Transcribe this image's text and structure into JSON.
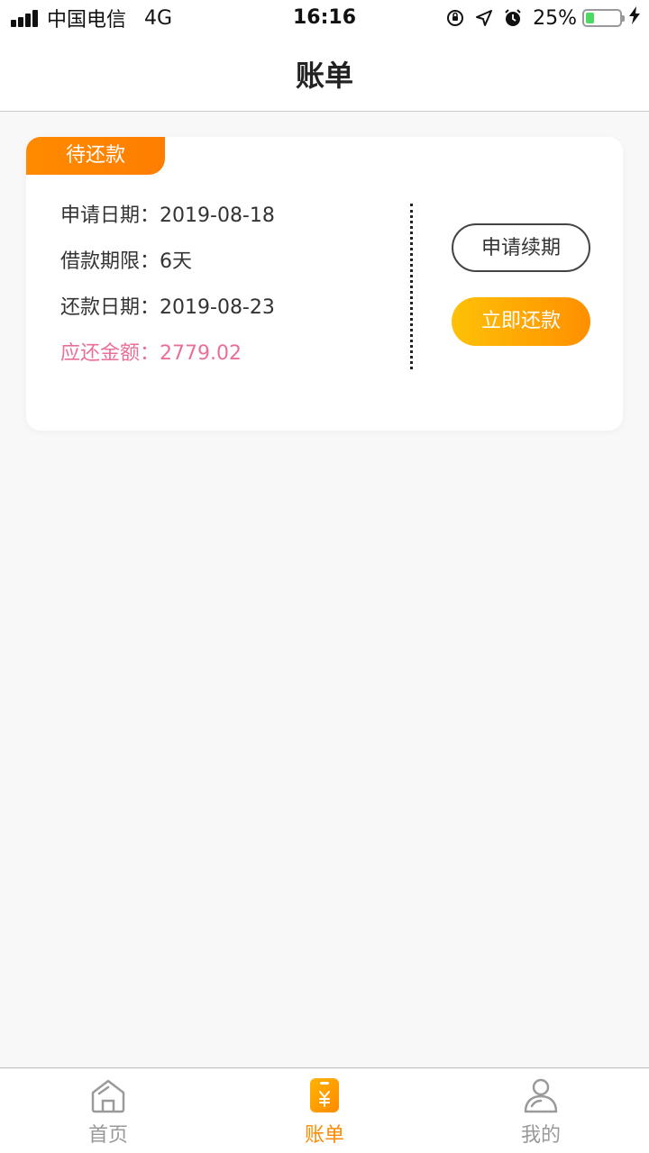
{
  "status_bar": {
    "carrier": "中国电信",
    "network": "4G",
    "time": "16:16",
    "battery_pct": "25%",
    "battery_level": 0.25,
    "icons": [
      "signal-icon",
      "orientation-lock-icon",
      "location-icon",
      "alarm-icon",
      "battery-icon",
      "charging-icon"
    ]
  },
  "nav": {
    "title": "账单"
  },
  "bill": {
    "status": "待还款",
    "rows": [
      {
        "label": "申请日期：",
        "value": "2019-08-18"
      },
      {
        "label": "借款期限：",
        "value": "6天"
      },
      {
        "label": "还款日期：",
        "value": "2019-08-23"
      }
    ],
    "due": {
      "label": "应还金额：",
      "value": "2779.02"
    },
    "renew_label": "申请续期",
    "repay_label": "立即还款"
  },
  "tabs": [
    {
      "label": "首页",
      "icon": "home-icon",
      "active": false
    },
    {
      "label": "账单",
      "icon": "bill-icon",
      "active": true
    },
    {
      "label": "我的",
      "icon": "profile-icon",
      "active": false
    }
  ],
  "colors": {
    "accent": "#ff8a00",
    "due_text": "#ea6f97",
    "repay_gradient_start": "#ffc107",
    "repay_gradient_end": "#ff8f00",
    "battery": "#4cd964"
  }
}
